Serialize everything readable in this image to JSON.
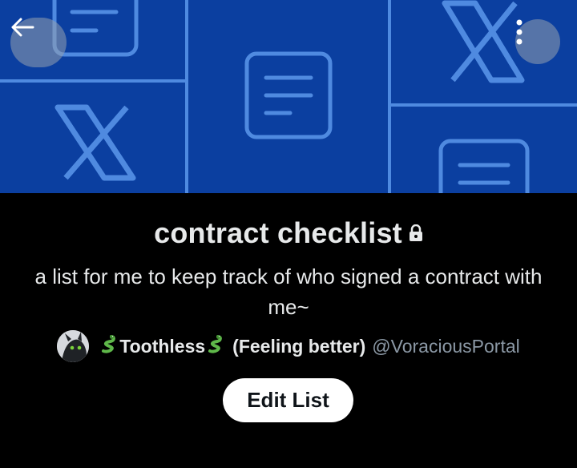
{
  "header": {
    "back_icon": "arrow-left-icon",
    "more_icon": "more-vertical-icon"
  },
  "list": {
    "title": "contract checklist",
    "privacy_icon": "lock-icon",
    "description": "a list for me to keep track of who signed a contract with me~",
    "owner": {
      "name_prefix_emoji": "snake",
      "display_name": "Toothless",
      "status": "(Feeling better)",
      "handle": "@VoraciousPortal"
    },
    "edit_label": "Edit List"
  },
  "colors": {
    "banner_background": "#0b3fa0",
    "banner_lines": "#4f8ae0",
    "page_background": "#000000",
    "primary_text": "#e7e9ea",
    "secondary_text": "#8b98a5",
    "button_background": "#ffffff"
  }
}
